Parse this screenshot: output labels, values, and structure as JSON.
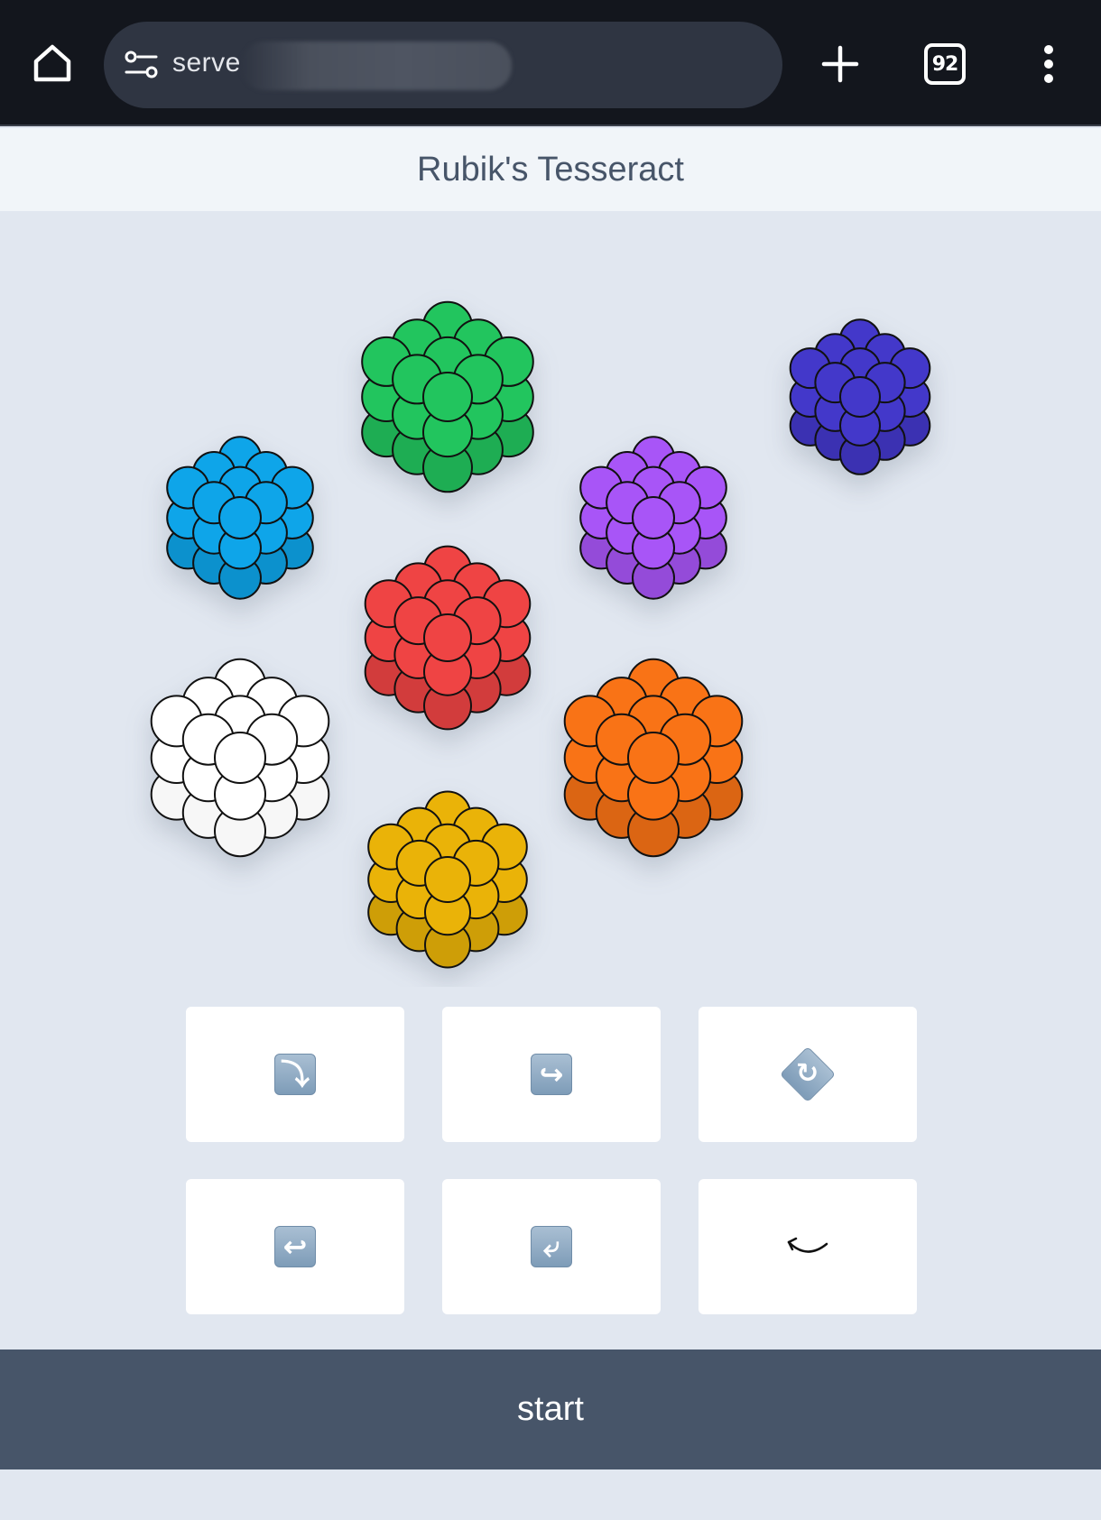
{
  "browser": {
    "url_text": "serve",
    "tab_count": "92",
    "icons": {
      "home": "home-icon",
      "site_settings": "tune-icon",
      "new_tab": "plus-icon",
      "tabs": "tab-switcher-icon",
      "menu": "more-vert-icon"
    }
  },
  "header": {
    "title": "Rubik's Tesseract"
  },
  "cubes": [
    {
      "name": "green",
      "color": "#22c55e"
    },
    {
      "name": "indigo",
      "color": "#4338ca"
    },
    {
      "name": "blue",
      "color": "#0ea5e9"
    },
    {
      "name": "purple",
      "color": "#a855f7"
    },
    {
      "name": "red",
      "color": "#ef4444"
    },
    {
      "name": "white",
      "color": "#ffffff"
    },
    {
      "name": "orange",
      "color": "#f97316"
    },
    {
      "name": "yellow",
      "color": "#eab308"
    }
  ],
  "controls": [
    {
      "glyph": "⤵️",
      "icon": "arrow-curve-down-right-icon"
    },
    {
      "glyph": "↪️",
      "icon": "arrow-right-hook-icon"
    },
    {
      "glyph": "⤾",
      "icon": "rotate-clockwise-diamond-icon"
    },
    {
      "glyph": "↩️",
      "icon": "arrow-left-hook-icon"
    },
    {
      "glyph": "↙️",
      "icon": "arrow-curve-down-left-icon"
    },
    {
      "glyph": "↶",
      "icon": "rotate-counterclockwise-icon"
    }
  ],
  "footer": {
    "start_label": "start"
  }
}
